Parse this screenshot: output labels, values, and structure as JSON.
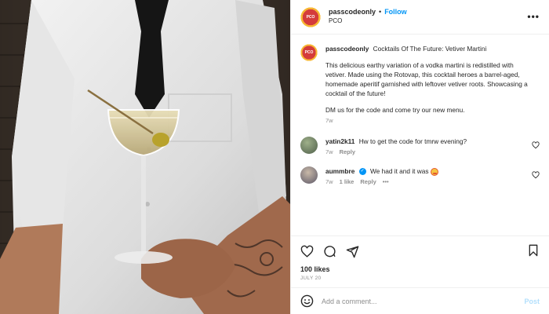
{
  "header": {
    "username": "passcodeonly",
    "dot": "•",
    "follow_label": "Follow",
    "subtitle": "PCO",
    "avatar_text": "PCO",
    "more_label": "•••"
  },
  "caption": {
    "username": "passcodeonly",
    "title": "Cocktails Of The Future: Vetiver Martini",
    "paragraph": "This delicious earthy variation of a vodka martini is redistilled with vetiver. Made using the Rotovap, this cocktail heroes a barrel-aged, homemade aperitif garnished with leftover vetiver roots. Showcasing a cocktail of the future!",
    "cta": "DM us for the code and come try our new menu.",
    "time": "7w"
  },
  "comments": [
    {
      "username": "yatin2k11",
      "text": "Hw to get the code for tmrw evening?",
      "time": "7w",
      "reply_label": "Reply"
    },
    {
      "username": "aummbre",
      "text": "We had it and it was",
      "time": "7w",
      "likes": "1 like",
      "reply_label": "Reply",
      "more_label": "•••"
    }
  ],
  "engagement": {
    "likes": "100 likes",
    "date": "JULY 20"
  },
  "add_comment": {
    "placeholder": "Add a comment...",
    "post_label": "Post"
  },
  "icons": {
    "like": "heart-icon",
    "comment": "comment-icon",
    "share": "share-icon",
    "save": "bookmark-icon",
    "emoji": "emoji-icon"
  },
  "colors": {
    "accent": "#0095f6",
    "post_disabled": "#b2dffc",
    "muted": "#8e8e8e",
    "border": "#efefef"
  }
}
